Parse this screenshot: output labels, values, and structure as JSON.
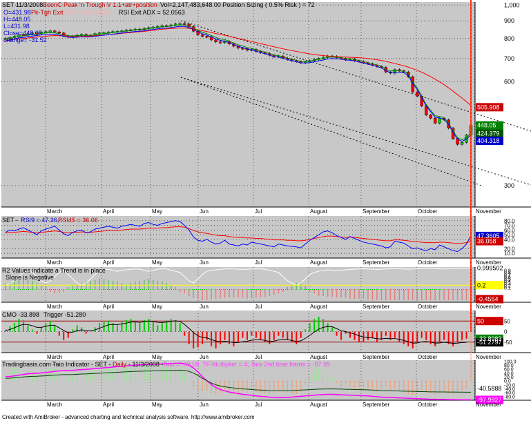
{
  "footer": "Created with AmiBroker - advanced charting and technical analysis software. http://www.amibroker.com",
  "colors": {
    "bg": "#c8c8c8",
    "up": "#00cc00",
    "down": "#ff0000",
    "blue": "#0000ff",
    "red": "#ff0000",
    "magenta": "#ff00ff",
    "green": "#008000",
    "dark": "#000000"
  },
  "chart_data": [
    {
      "type": "line",
      "panel": "price",
      "header": {
        "symbol": "SET 11/3/2008",
        "system": "BoonC Peak 'n Trough V 1.1+atr+position",
        "vol": "Vol=2,147,483,648.00 Position Sizing ( 0.5% Risk ) = 72",
        "o": "O=431.98",
        "pk": "Pk-Tgh Exit",
        "atr": "ATR Trailing Exit",
        "rsi_exit": "RSI Exit ADX = 52.0563",
        "h": "H=448.05",
        "l": "L=431.98",
        "close": "Close=448.05",
        "change": "change= -31.52"
      },
      "y_ticks": [
        "1,000",
        "900",
        "800",
        "700",
        "600",
        "300"
      ],
      "y_tick_values": [
        1000,
        900,
        800,
        700,
        600,
        300
      ],
      "value_labels": [
        {
          "text": "505.908",
          "color": "#cc0000",
          "v": 505.908
        },
        {
          "text": "448.05",
          "color": "#008000",
          "v": 448.05
        },
        {
          "text": "424.379",
          "color": "#005500",
          "v": 424.379
        },
        {
          "text": "404.318",
          "color": "#0000cc",
          "v": 404.318
        }
      ],
      "close": [
        800,
        805,
        812,
        820,
        818,
        825,
        830,
        828,
        835,
        838,
        842,
        836,
        830,
        815,
        808,
        812,
        818,
        822,
        815,
        818,
        826,
        830,
        832,
        835,
        838,
        840,
        842,
        846,
        848,
        852,
        850,
        856,
        860,
        864,
        868,
        872,
        870,
        876,
        882,
        884,
        880,
        866,
        840,
        820,
        812,
        808,
        792,
        782,
        778,
        784,
        772,
        760,
        750,
        748,
        740,
        744,
        734,
        728,
        724,
        716,
        708,
        712,
        702,
        696,
        690,
        686,
        680,
        684,
        690,
        696,
        700,
        706,
        712,
        710,
        704,
        700,
        694,
        698,
        690,
        686,
        680,
        676,
        670,
        664,
        660,
        640,
        635,
        650,
        645,
        640,
        620,
        560,
        545,
        510,
        480,
        470,
        455,
        470,
        465,
        440,
        410,
        395,
        400,
        420,
        448.05
      ],
      "ma_red": [
        790,
        792,
        795,
        798,
        800,
        803,
        806,
        808,
        810,
        812,
        814,
        816,
        815,
        814,
        812,
        811,
        810,
        811,
        812,
        813,
        815,
        817,
        819,
        821,
        823,
        825,
        828,
        830,
        832,
        835,
        837,
        839,
        842,
        845,
        848,
        851,
        853,
        855,
        857,
        858,
        858,
        856,
        852,
        848,
        843,
        838,
        833,
        827,
        822,
        817,
        812,
        806,
        800,
        795,
        790,
        784,
        779,
        773,
        768,
        762,
        757,
        752,
        747,
        742,
        738,
        734,
        730,
        726,
        722,
        719,
        716,
        714,
        712,
        710,
        709,
        708,
        707,
        706,
        705,
        704,
        702,
        700,
        697,
        694,
        691,
        687,
        682,
        677,
        672,
        667,
        661,
        654,
        647,
        639,
        630,
        620,
        610,
        599,
        588,
        576,
        563,
        550,
        538,
        525,
        512
      ],
      "ma_green": [
        795,
        800,
        806,
        812,
        814,
        818,
        822,
        824,
        828,
        830,
        832,
        830,
        827,
        820,
        815,
        814,
        815,
        817,
        816,
        817,
        820,
        823,
        826,
        829,
        832,
        835,
        838,
        841,
        844,
        847,
        848,
        851,
        855,
        858,
        862,
        865,
        866,
        869,
        873,
        876,
        876,
        870,
        858,
        845,
        834,
        826,
        816,
        806,
        798,
        794,
        786,
        776,
        767,
        761,
        753,
        749,
        742,
        736,
        730,
        723,
        716,
        714,
        708,
        702,
        697,
        692,
        687,
        686,
        688,
        692,
        696,
        700,
        705,
        707,
        706,
        704,
        700,
        699,
        695,
        691,
        686,
        681,
        676,
        670,
        665,
        652,
        644,
        646,
        645,
        643,
        632,
        598,
        575,
        545,
        515,
        496,
        478,
        476,
        471,
        456,
        432,
        413,
        407,
        413,
        424.379
      ]
    },
    {
      "type": "line",
      "panel": "rsi",
      "header": {
        "symbol": "SET - ",
        "rsi9": "RSI9 = 47.36, ",
        "rsi45": "RSI45 = 36.06"
      },
      "y_ticks": [
        "80.0",
        "70.0",
        "60.0",
        "50.0",
        "40.0",
        "20.0",
        "10.0"
      ],
      "y_tick_values": [
        80,
        70,
        60,
        50,
        40,
        20,
        10
      ],
      "value_labels": [
        {
          "text": "47.3605",
          "color": "#0000cc",
          "v": 47.36
        },
        {
          "text": "36.058",
          "color": "#cc0000",
          "v": 36.06
        }
      ],
      "rsi9": [
        55,
        60,
        58,
        62,
        65,
        60,
        55,
        50,
        58,
        62,
        65,
        68,
        60,
        52,
        48,
        55,
        58,
        60,
        54,
        56,
        62,
        64,
        66,
        68,
        66,
        64,
        68,
        70,
        72,
        70,
        68,
        74,
        76,
        72,
        70,
        74,
        76,
        78,
        80,
        78,
        70,
        60,
        45,
        38,
        36,
        40,
        34,
        30,
        32,
        38,
        30,
        28,
        26,
        30,
        28,
        34,
        32,
        30,
        28,
        26,
        24,
        30,
        28,
        26,
        25,
        24,
        22,
        30,
        38,
        44,
        50,
        56,
        58,
        54,
        48,
        44,
        40,
        46,
        42,
        38,
        34,
        32,
        30,
        28,
        26,
        22,
        24,
        36,
        34,
        32,
        26,
        20,
        22,
        18,
        16,
        20,
        18,
        28,
        24,
        20,
        16,
        14,
        20,
        30,
        47.36
      ],
      "rsi45": [
        54,
        55,
        55,
        56,
        57,
        56,
        55,
        54,
        55,
        56,
        57,
        58,
        57,
        55,
        54,
        55,
        55,
        56,
        55,
        55,
        56,
        57,
        58,
        59,
        59,
        59,
        60,
        61,
        62,
        62,
        62,
        63,
        64,
        64,
        64,
        65,
        65,
        66,
        67,
        67,
        66,
        63,
        59,
        56,
        54,
        53,
        51,
        49,
        48,
        48,
        46,
        45,
        44,
        44,
        43,
        43,
        42,
        42,
        41,
        40,
        39,
        39,
        39,
        38,
        38,
        37,
        37,
        38,
        40,
        42,
        44,
        46,
        47,
        47,
        46,
        45,
        44,
        45,
        44,
        43,
        42,
        41,
        40,
        39,
        38,
        37,
        37,
        39,
        39,
        38,
        37,
        35,
        35,
        34,
        33,
        33,
        33,
        34,
        34,
        33,
        32,
        31,
        32,
        33,
        36.06
      ]
    },
    {
      "type": "bar",
      "panel": "r2",
      "header": {
        "line1": "R2 Values indicate a Trend is in place",
        "line2": "Slope is Negative"
      },
      "y_ticks": [
        "0.9",
        "0.8",
        "0.7",
        "0.6",
        "0.5",
        "0.4",
        "0.3",
        "0.2",
        "0.1"
      ],
      "value_labels": [
        {
          "text": "0.999502",
          "color": "#000000",
          "v": 0.9995
        },
        {
          "text": "0.2",
          "color": "#ffff00",
          "v": 0.2
        },
        {
          "text": "-0.4554",
          "color": "#cc0000",
          "v": -0.4554
        }
      ],
      "r2": [
        0.2,
        0.3,
        0.4,
        0.6,
        0.8,
        0.9,
        0.8,
        0.6,
        0.4,
        0.3,
        0.4,
        0.6,
        0.8,
        0.9,
        0.7,
        0.5,
        0.3,
        0.2,
        0.3,
        0.5,
        0.7,
        0.85,
        0.9,
        0.95,
        0.9,
        0.85,
        0.9,
        0.92,
        0.95,
        0.96,
        0.95,
        0.9,
        0.85,
        0.9,
        0.95,
        0.97,
        0.96,
        0.9,
        0.85,
        0.8,
        0.6,
        0.4,
        0.3,
        0.5,
        0.7,
        0.85,
        0.9,
        0.92,
        0.95,
        0.96,
        0.97,
        0.96,
        0.95,
        0.94,
        0.95,
        0.96,
        0.97,
        0.96,
        0.95,
        0.9,
        0.85,
        0.8,
        0.6,
        0.4,
        0.3,
        0.2,
        0.3,
        0.5,
        0.7,
        0.8,
        0.85,
        0.9,
        0.92,
        0.9,
        0.88,
        0.9,
        0.92,
        0.94,
        0.95,
        0.96,
        0.97,
        0.96,
        0.95,
        0.94,
        0.95,
        0.96,
        0.97,
        0.98,
        0.97,
        0.96,
        0.95,
        0.96,
        0.97,
        0.98,
        0.99,
        0.99,
        0.98,
        0.97,
        0.96,
        0.97,
        0.98,
        0.99,
        0.99,
        0.99,
        0.9995
      ],
      "slope": [
        0.3,
        0.35,
        0.4,
        0.45,
        0.5,
        0.45,
        0.4,
        0.3,
        0.2,
        0.1,
        -0.1,
        -0.2,
        -0.15,
        -0.1,
        0.1,
        0.2,
        0.25,
        0.3,
        0.35,
        0.4,
        0.45,
        0.5,
        0.5,
        0.45,
        0.4,
        0.35,
        0.3,
        0.25,
        0.3,
        0.35,
        0.4,
        0.45,
        0.5,
        0.45,
        0.4,
        0.35,
        0.3,
        0.2,
        0.1,
        -0.1,
        -0.2,
        -0.3,
        -0.4,
        -0.45,
        -0.5,
        -0.5,
        -0.48,
        -0.45,
        -0.42,
        -0.4,
        -0.38,
        -0.36,
        -0.38,
        -0.4,
        -0.42,
        -0.4,
        -0.38,
        -0.36,
        -0.34,
        -0.3,
        -0.26,
        -0.2,
        -0.1,
        0.1,
        0.2,
        0.3,
        0.3,
        0.2,
        -0.1,
        -0.2,
        -0.3,
        -0.32,
        -0.34,
        -0.35,
        -0.36,
        -0.38,
        -0.4,
        -0.42,
        -0.44,
        -0.45,
        -0.46,
        -0.47,
        -0.48,
        -0.5,
        -0.5,
        -0.5,
        -0.5,
        -0.5,
        -0.5,
        -0.5,
        -0.5,
        -0.5,
        -0.5,
        -0.5,
        -0.5,
        -0.5,
        -0.5,
        -0.5,
        -0.5,
        -0.5,
        -0.5,
        -0.5,
        -0.5,
        -0.5,
        -0.4554
      ]
    },
    {
      "type": "bar",
      "panel": "cmo",
      "header": {
        "cmo": "CMO -33.898",
        "trigger": "Trigger -51.280"
      },
      "y_ticks": [
        "50",
        "0",
        "-50"
      ],
      "value_labels": [
        {
          "text": "50",
          "color": "#cc0000",
          "v": 50
        },
        {
          "text": "-33.8983",
          "color": "#008000",
          "v": -33.8983
        },
        {
          "text": "-51.2797",
          "color": "#000000",
          "v": -51.2797
        }
      ],
      "cmo": [
        10,
        25,
        40,
        60,
        55,
        30,
        10,
        -10,
        20,
        40,
        50,
        30,
        -20,
        -40,
        -30,
        10,
        30,
        20,
        -10,
        0,
        20,
        40,
        45,
        50,
        40,
        30,
        45,
        55,
        60,
        50,
        40,
        55,
        60,
        45,
        30,
        40,
        50,
        60,
        55,
        40,
        -20,
        -60,
        -80,
        -75,
        -60,
        -40,
        -70,
        -80,
        -60,
        -40,
        -60,
        -70,
        -50,
        -30,
        -40,
        -20,
        -30,
        -40,
        -50,
        -60,
        -40,
        -20,
        -30,
        -40,
        -50,
        -60,
        -30,
        10,
        40,
        60,
        70,
        60,
        40,
        20,
        -20,
        -40,
        -10,
        -30,
        -40,
        -50,
        -50,
        -40,
        -30,
        -50,
        -40,
        -20,
        -40,
        -30,
        -50,
        -60,
        -70,
        -80,
        -50,
        -30,
        -40,
        -60,
        -70,
        -50,
        -40,
        -60,
        -70,
        -50,
        -40,
        -33.9
      ],
      "trigger": [
        5,
        10,
        18,
        28,
        34,
        33,
        28,
        20,
        20,
        25,
        30,
        30,
        18,
        5,
        -5,
        -3,
        5,
        8,
        5,
        4,
        8,
        16,
        24,
        32,
        34,
        33,
        36,
        40,
        45,
        46,
        44,
        47,
        50,
        48,
        44,
        43,
        45,
        49,
        51,
        48,
        34,
        15,
        -5,
        -20,
        -28,
        -30,
        -38,
        -45,
        -48,
        -46,
        -49,
        -53,
        -52,
        -48,
        -46,
        -41,
        -39,
        -39,
        -42,
        -47,
        -45,
        -40,
        -38,
        -39,
        -42,
        -47,
        -44,
        -32,
        -18,
        -2,
        12,
        20,
        24,
        23,
        14,
        4,
        0,
        -6,
        -12,
        -20,
        -26,
        -29,
        -30,
        -34,
        -35,
        -32,
        -34,
        -33,
        -37,
        -42,
        -48,
        -55,
        -54,
        -49,
        -47,
        -50,
        -55,
        -54,
        -51,
        -53,
        -56,
        -55,
        -52,
        -51.28
      ]
    },
    {
      "type": "bar",
      "panel": "taio",
      "header": {
        "site": "Tradingbasis.com - ",
        "name": "Taio Indicator - SET - ",
        "daily": "Daily",
        "date": " - 11/3/2008 - ",
        "taio": "Taio = -40.59, TF-Multiplier = 4, Taio 2nd time frame = -97.99"
      },
      "y_ticks": [
        "100.0",
        "80.0",
        "60.0",
        "40.0",
        "20.0",
        "0.0",
        "-20.0",
        "-40.0",
        "-60.0",
        "-80.0"
      ],
      "value_labels": [
        {
          "text": "-40.5888",
          "color": "#000000",
          "v": -40.59
        },
        {
          "text": "-97.9927",
          "color": "#ff00ff",
          "v": -97.99
        }
      ],
      "taio": [
        40,
        55,
        70,
        80,
        70,
        55,
        40,
        30,
        45,
        60,
        70,
        60,
        40,
        20,
        10,
        25,
        40,
        50,
        45,
        45,
        55,
        65,
        70,
        75,
        72,
        70,
        75,
        80,
        85,
        82,
        80,
        85,
        88,
        84,
        80,
        84,
        88,
        90,
        88,
        80,
        40,
        0,
        -30,
        -50,
        -55,
        -50,
        -60,
        -70,
        -65,
        -55,
        -60,
        -70,
        -65,
        -55,
        -60,
        -50,
        -55,
        -60,
        -65,
        -70,
        -60,
        -50,
        -55,
        -60,
        -65,
        -70,
        -55,
        -20,
        20,
        50,
        70,
        60,
        40,
        20,
        -10,
        -30,
        -20,
        -30,
        -40,
        -45,
        -50,
        -45,
        -40,
        -50,
        -45,
        -35,
        -45,
        -40,
        -50,
        -60,
        -70,
        -75,
        -60,
        -50,
        -55,
        -65,
        -70,
        -60,
        -55,
        -65,
        -70,
        -60,
        -50,
        -40.59
      ],
      "taio2": [
        20,
        22,
        25,
        28,
        32,
        35,
        37,
        38,
        40,
        42,
        45,
        48,
        50,
        52,
        52,
        53,
        55,
        57,
        58,
        60,
        62,
        64,
        66,
        68,
        70,
        72,
        74,
        76,
        78,
        80,
        81,
        82,
        83,
        84,
        85,
        86,
        87,
        88,
        89,
        90,
        88,
        80,
        65,
        45,
        20,
        0,
        -20,
        -35,
        -45,
        -52,
        -58,
        -62,
        -66,
        -70,
        -72,
        -75,
        -78,
        -80,
        -82,
        -84,
        -85,
        -86,
        -86,
        -85,
        -84,
        -82,
        -80,
        -78,
        -76,
        -74,
        -72,
        -71,
        -70,
        -70,
        -71,
        -72,
        -73,
        -74,
        -75,
        -76,
        -77,
        -78,
        -80,
        -82,
        -84,
        -85,
        -86,
        -87,
        -88,
        -89,
        -90,
        -91,
        -92,
        -93,
        -94,
        -95,
        -95,
        -96,
        -96,
        -97,
        -97,
        -97.5,
        -97.8,
        -97.9,
        -97.99
      ]
    }
  ],
  "months": [
    "March",
    "April",
    "May",
    "Jun",
    "Jul",
    "August",
    "September",
    "October",
    "November"
  ]
}
